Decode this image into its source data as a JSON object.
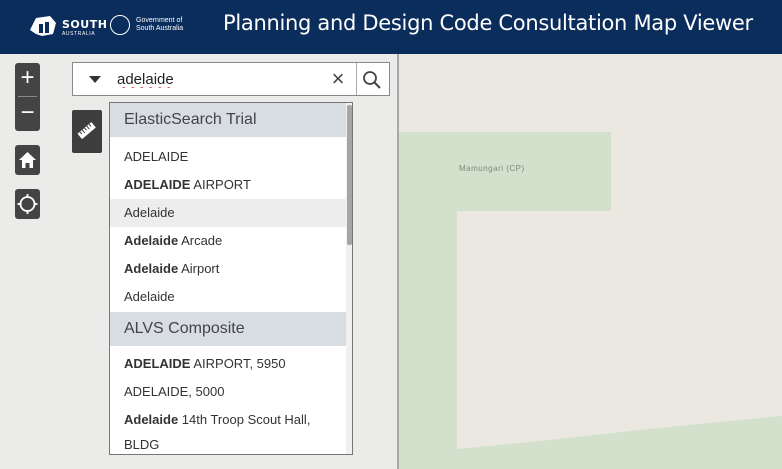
{
  "header": {
    "logo_text": "SOUTH",
    "logo_subtext": "AUSTRALIA",
    "gov_line1": "Government of",
    "gov_line2": "South Australia",
    "title": "Planning and Design Code Consultation Map Viewer",
    "background_color": "#0b2d5c"
  },
  "map": {
    "label": "Mamungari (CP)",
    "park_color": "#d3e1cc"
  },
  "controls": {
    "zoom_in": "+",
    "zoom_out": "−",
    "home_icon": "home-icon",
    "locate_icon": "crosshair-icon",
    "measure_icon": "ruler-icon"
  },
  "search": {
    "value": "adelaide",
    "clear_label": "×",
    "search_icon": "search-icon"
  },
  "results": {
    "groups": [
      {
        "name": "ElasticSearch Trial",
        "items": [
          {
            "bold": "",
            "rest": "ADELAIDE",
            "highlighted": false
          },
          {
            "bold": "ADELAIDE",
            "rest": " AIRPORT",
            "highlighted": false
          },
          {
            "bold": "",
            "rest": "Adelaide",
            "highlighted": true
          },
          {
            "bold": "Adelaide",
            "rest": " Arcade",
            "highlighted": false
          },
          {
            "bold": "Adelaide",
            "rest": " Airport",
            "highlighted": false
          },
          {
            "bold": "",
            "rest": "Adelaide",
            "highlighted": false
          }
        ]
      },
      {
        "name": "ALVS Composite",
        "items": [
          {
            "bold": "ADELAIDE",
            "rest": " AIRPORT, 5950",
            "highlighted": false
          },
          {
            "bold": "",
            "rest": "ADELAIDE, 5000",
            "highlighted": false
          },
          {
            "bold": "Adelaide",
            "rest": " 14th Troop Scout Hall,",
            "highlighted": false
          },
          {
            "bold": "",
            "rest": "BLDG",
            "highlighted": false
          }
        ]
      }
    ]
  }
}
